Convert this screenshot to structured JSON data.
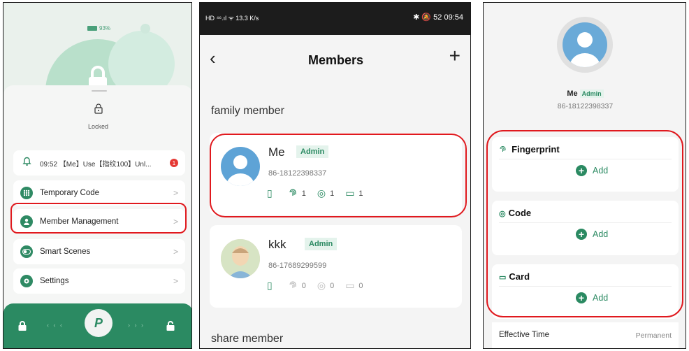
{
  "panel1": {
    "battery": "93%",
    "lock_status": "Locked",
    "notification": {
      "time": "09:52",
      "text": "09:52 【Me】Use【指纹100】Unl...",
      "badge": "1"
    },
    "menu": [
      {
        "label": "Temporary Code",
        "icon": "grid-icon"
      },
      {
        "label": "Member Management",
        "icon": "person-icon"
      },
      {
        "label": "Smart Scenes",
        "icon": "toggle-icon"
      },
      {
        "label": "Settings",
        "icon": "gear-icon"
      }
    ],
    "bottom": {
      "left_arrows": "‹ ‹ ‹",
      "right_arrows": "› › ›",
      "center_glyph": "P"
    },
    "colors": {
      "accent": "#2b8a62",
      "highlight": "#e0191e"
    }
  },
  "panel2": {
    "status_left": "HD ⁴⁶.ıl ᯤ 13.3 K/s",
    "status_right": "✱ 🔕 52 09:54",
    "title": "Members",
    "section_family": "family member",
    "section_share": "share member",
    "members": [
      {
        "name": "Me",
        "role": "Admin",
        "phone": "86-18122398337",
        "fingerprint": "1",
        "code": "1",
        "card": "1"
      },
      {
        "name": "kkk",
        "role": "Admin",
        "phone": "86-17689299599",
        "fingerprint": "0",
        "code": "0",
        "card": "0"
      }
    ]
  },
  "panel3": {
    "name": "Me",
    "role": "Admin",
    "phone": "86-18122398337",
    "credentials": [
      {
        "title": "Fingerprint",
        "add": "Add"
      },
      {
        "title": "Code",
        "add": "Add"
      },
      {
        "title": "Card",
        "add": "Add"
      }
    ],
    "effective_time_label": "Effective Time",
    "effective_time_value": "Permanent"
  }
}
